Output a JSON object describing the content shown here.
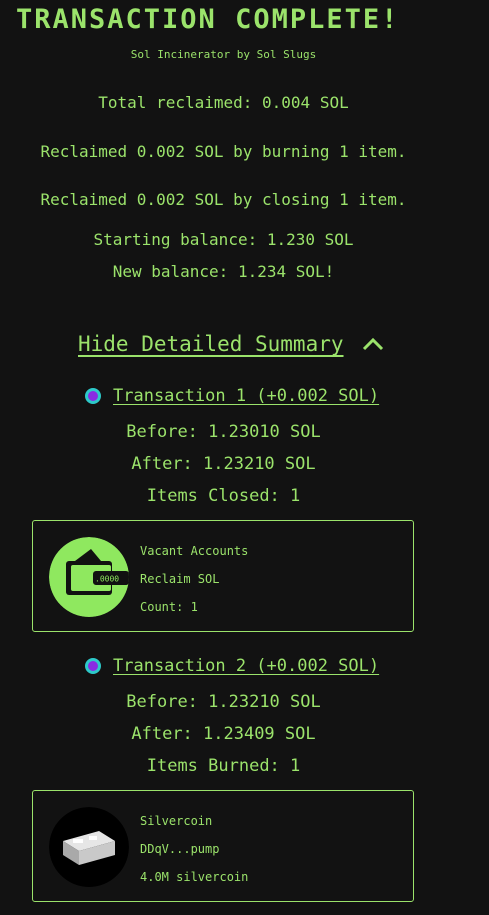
{
  "header": {
    "title": "TRANSACTION COMPLETE!",
    "subtitle": "Sol Incinerator by Sol Slugs"
  },
  "summary": {
    "total": "Total reclaimed: 0.004 SOL",
    "burned": "Reclaimed 0.002 SOL by burning 1 item.",
    "closed": "Reclaimed 0.002 SOL by closing 1 item.",
    "starting": "Starting balance: 1.230 SOL",
    "new": "New balance: 1.234 SOL!"
  },
  "details_toggle": {
    "label": "Hide Detailed Summary",
    "icon": "chevron-up-icon"
  },
  "transactions": [
    {
      "link": "Transaction 1 (+0.002 SOL)",
      "before": "Before: 1.23010 SOL",
      "after": "After: 1.23210 SOL",
      "items": "Items Closed: 1",
      "card": {
        "name": "Vacant Accounts",
        "line2": "Reclaim SOL",
        "line3": "Count: 1",
        "icon": "wallet-icon",
        "icon_bg": "#8fe85f"
      }
    },
    {
      "link": "Transaction 2 (+0.002 SOL)",
      "before": "Before: 1.23210 SOL",
      "after": "After: 1.23409 SOL",
      "items": "Items Burned: 1",
      "card": {
        "name": "Silvercoin",
        "line2": "DDqV...pump",
        "line3": "4.0M silvercoin",
        "icon": "silver-bar-icon",
        "icon_bg": "#000000"
      }
    }
  ],
  "colors": {
    "accent": "#9be36b",
    "background": "#121212",
    "dot_ring": "#2dc9c9",
    "dot_fill": "#8a2be2"
  }
}
